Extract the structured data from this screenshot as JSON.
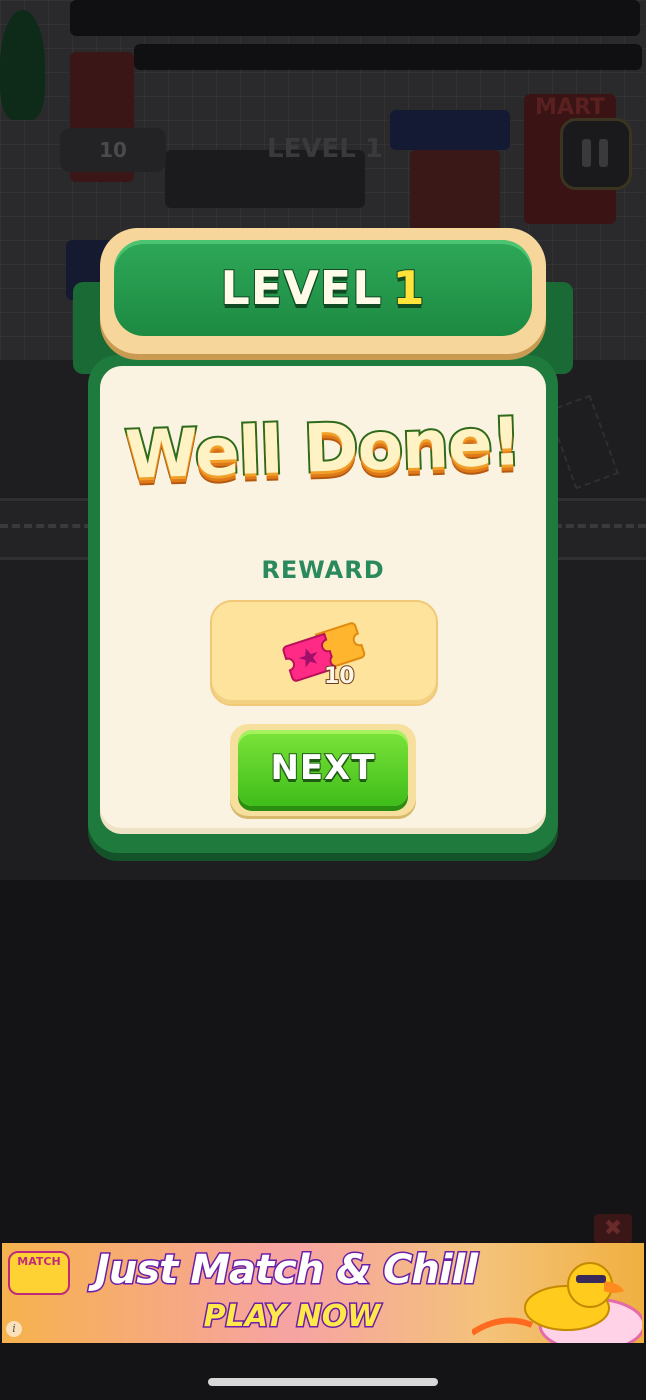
{
  "background": {
    "coin_counter": "10",
    "level_label": "LEVEL 1",
    "shop_sign": "MART"
  },
  "dialog": {
    "title_word": "LEVEL",
    "title_number": "1",
    "headline": "Well Done!",
    "reward_label": "REWARD",
    "reward_item": {
      "icon": "ticket-icon",
      "count": "10"
    },
    "next_label": "NEXT"
  },
  "ad": {
    "brand": "MATCH",
    "headline": "Just Match & Chill",
    "cta": "PLAY NOW",
    "close_glyph": "✖",
    "info_glyph": "i"
  },
  "colors": {
    "dialog_green": "#1f7a3d",
    "dialog_cream": "#faf3e1",
    "button_green": "#3fbd1a",
    "level_number_yellow": "#ffe23a",
    "reward_label_teal": "#2a8a5e"
  }
}
